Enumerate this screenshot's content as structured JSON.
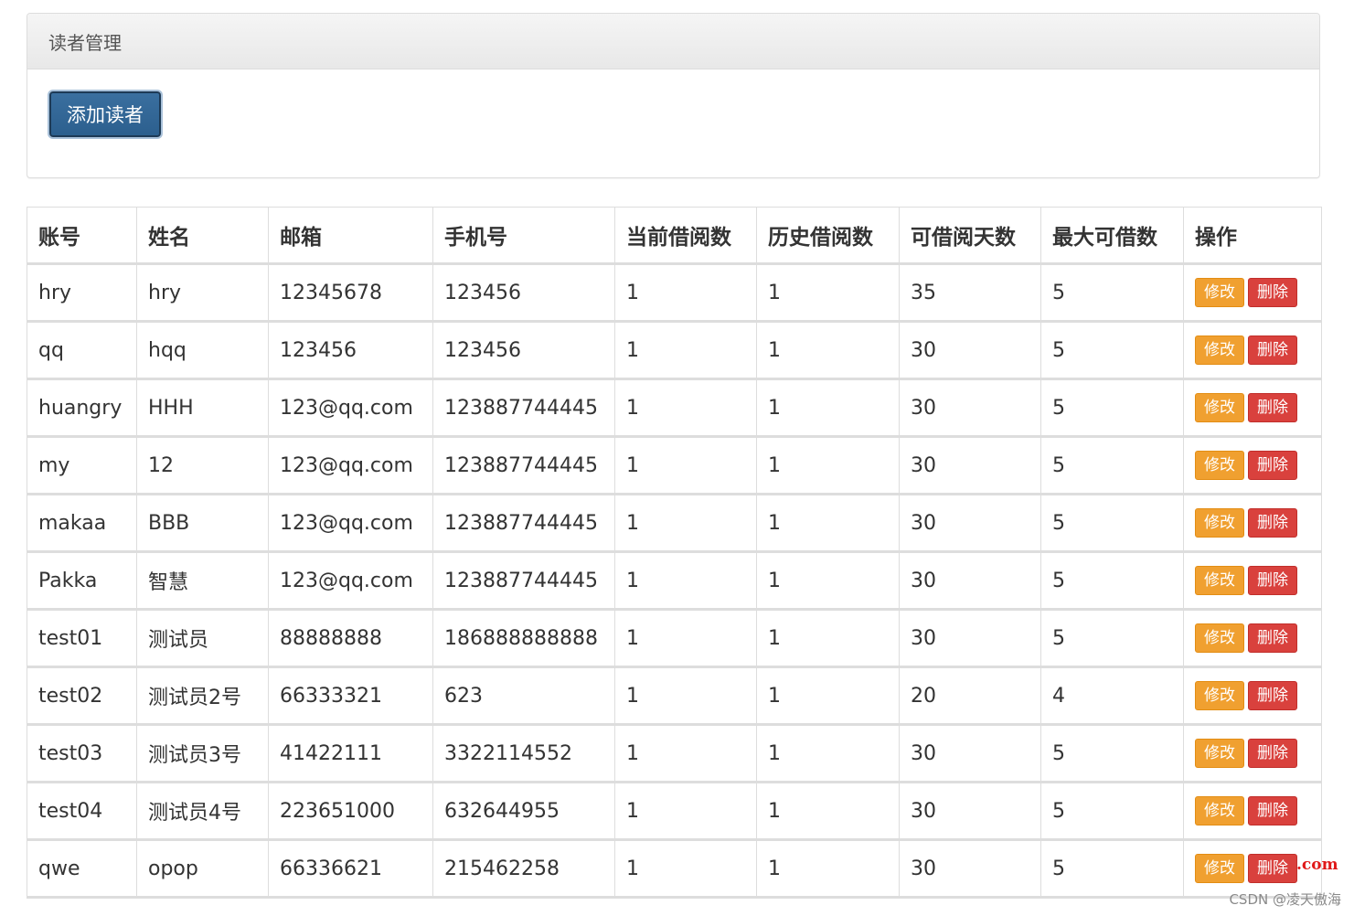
{
  "panel": {
    "title": "读者管理",
    "add_button_label": "添加读者"
  },
  "table": {
    "headers": [
      "账号",
      "姓名",
      "邮箱",
      "手机号",
      "当前借阅数",
      "历史借阅数",
      "可借阅天数",
      "最大可借数",
      "操作"
    ],
    "rows": [
      [
        "hry",
        "hry",
        "12345678",
        "123456",
        "1",
        "1",
        "35",
        "5"
      ],
      [
        "qq",
        "hqq",
        "123456",
        "123456",
        "1",
        "1",
        "30",
        "5"
      ],
      [
        "huangry",
        "HHH",
        "123@qq.com",
        "123887744445",
        "1",
        "1",
        "30",
        "5"
      ],
      [
        "my",
        "12",
        "123@qq.com",
        "123887744445",
        "1",
        "1",
        "30",
        "5"
      ],
      [
        "makaa",
        "BBB",
        "123@qq.com",
        "123887744445",
        "1",
        "1",
        "30",
        "5"
      ],
      [
        "Pakka",
        "智慧",
        "123@qq.com",
        "123887744445",
        "1",
        "1",
        "30",
        "5"
      ],
      [
        "test01",
        "测试员",
        "88888888",
        "186888888888",
        "1",
        "1",
        "30",
        "5"
      ],
      [
        "test02",
        "测试员2号",
        "66333321",
        "623",
        "1",
        "1",
        "20",
        "4"
      ],
      [
        "test03",
        "测试员3号",
        "41422111",
        "3322114552",
        "1",
        "1",
        "30",
        "5"
      ],
      [
        "test04",
        "测试员4号",
        "223651000",
        "632644955",
        "1",
        "1",
        "30",
        "5"
      ],
      [
        "qwe",
        "opop",
        "66336621",
        "215462258",
        "1",
        "1",
        "30",
        "5"
      ]
    ],
    "edit_label": "修改",
    "delete_label": "删除"
  },
  "overlay_mark": ".com",
  "watermark": "CSDN @凌天傲海",
  "colors": {
    "primary": "#2c5f8e",
    "warning": "#f0a030",
    "danger": "#d9413d",
    "border": "#dddddd"
  }
}
